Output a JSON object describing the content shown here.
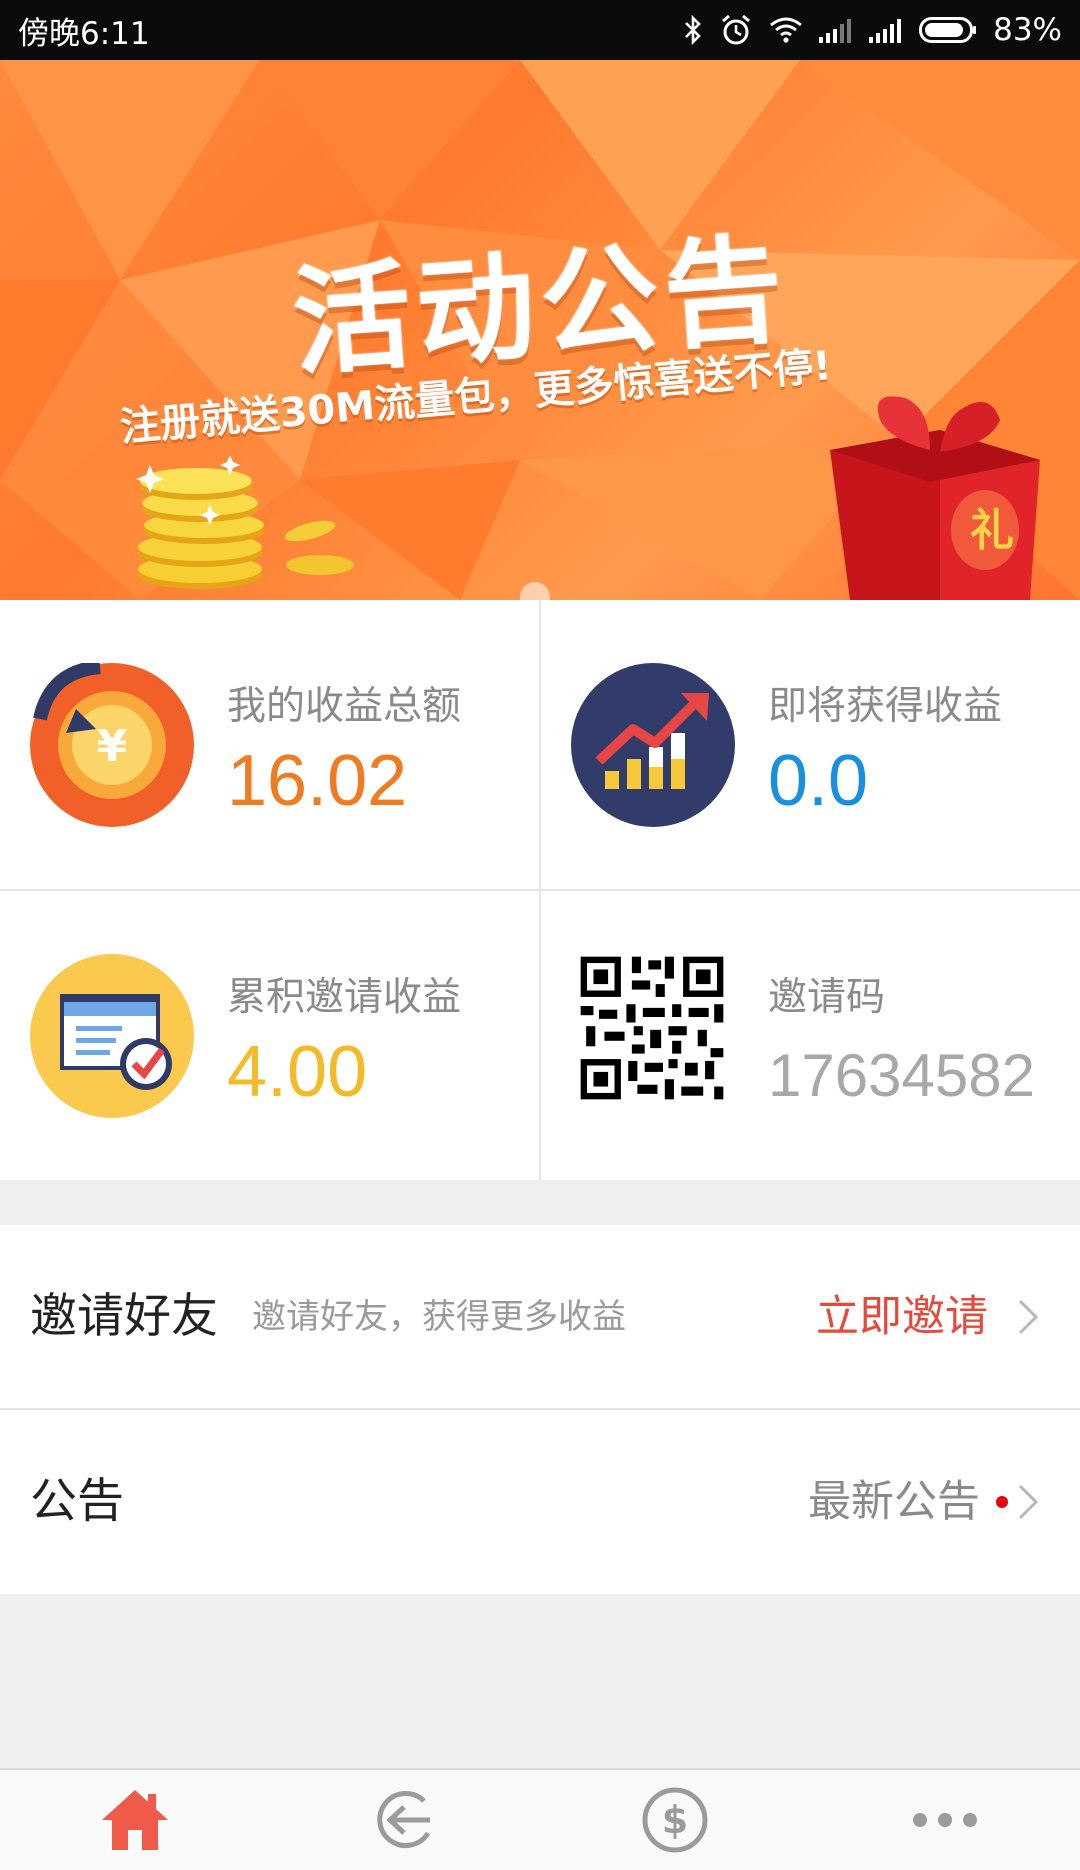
{
  "status_bar": {
    "time": "傍晚6:11",
    "battery": "83%",
    "icons": [
      "bluetooth-icon",
      "alarm-icon",
      "wifi-icon",
      "signal-icon",
      "signal-icon",
      "battery-icon"
    ]
  },
  "banner": {
    "title": "活动公告",
    "subtitle": "注册就送30M流量包，更多惊喜送不停!",
    "gift_char": "礼",
    "colors": {
      "primary": "#ff7a2e",
      "light": "#ffb45a"
    }
  },
  "stats": {
    "total_income": {
      "label": "我的收益总额",
      "value": "16.02",
      "color": "#f07b20",
      "icon": "yen-coin-icon"
    },
    "upcoming_income": {
      "label": "即将获得收益",
      "value": "0.0",
      "color": "#1a8fe0",
      "icon": "growth-chart-icon"
    },
    "invite_income": {
      "label": "累积邀请收益",
      "value": "4.00",
      "color": "#f3bb2a",
      "icon": "checklist-icon"
    },
    "invite_code": {
      "label": "邀请码",
      "value": "17634582",
      "color": "#a8a8a8",
      "icon": "qr-code-icon"
    }
  },
  "rows": {
    "invite": {
      "title": "邀请好友",
      "desc": "邀请好友，获得更多收益",
      "action": "立即邀请",
      "action_color": "#e8483a"
    },
    "notice": {
      "title": "公告",
      "action": "最新公告",
      "action_color": "#8a8a8a"
    }
  },
  "bottom_nav": {
    "items": [
      {
        "icon": "home-icon",
        "active": true
      },
      {
        "icon": "back-circle-icon",
        "active": false
      },
      {
        "icon": "dollar-icon",
        "active": false
      },
      {
        "icon": "more-icon",
        "active": false
      }
    ],
    "active_color": "#f05a4a",
    "inactive_color": "#9b9b9b"
  }
}
